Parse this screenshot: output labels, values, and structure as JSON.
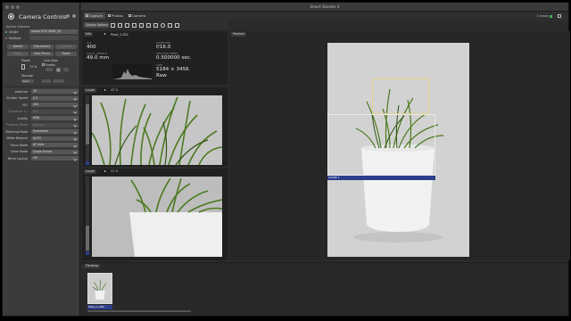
{
  "window": {
    "title": "Smart Shooter 4"
  },
  "left_panel": {
    "title": "Camera Controls",
    "section_active": "Active Camera",
    "single_label": "Single",
    "camera_model": "Canon EOS 5DSR_T6",
    "multiple_label": "Multiple",
    "buttons": [
      "Detect",
      "Disconnect",
      "Connect"
    ],
    "buttons2": [
      "Sleep",
      "Auto Focus",
      "Reset"
    ],
    "power_label": "Power",
    "power_value": "75 %",
    "liveview_label": "Live View",
    "enable_label": "Enable",
    "storage_label": "Storage",
    "storage_value": "Card",
    "settings": [
      {
        "label": "Aperture",
        "value": "16",
        "dim": false
      },
      {
        "label": "Shutter Speed",
        "value": "0.5",
        "dim": false
      },
      {
        "label": "ISO",
        "value": "400",
        "dim": false
      },
      {
        "label": "Exposure +/-",
        "value": "0.0",
        "dim": true
      },
      {
        "label": "Quality",
        "value": "RAW",
        "dim": false
      },
      {
        "label": "Program Mode",
        "value": "Manual",
        "dim": true
      },
      {
        "label": "Metering Mode",
        "value": "Evaluative",
        "dim": false
      },
      {
        "label": "White Balance",
        "value": "AUTO",
        "dim": false
      },
      {
        "label": "Focus Mode",
        "value": "AF Auto",
        "dim": false
      },
      {
        "label": "Drive Mode",
        "value": "Single Frame",
        "dim": false
      },
      {
        "label": "Mirror Lockup",
        "value": "Off",
        "dim": false
      }
    ]
  },
  "tabs": [
    {
      "label": "Capture",
      "active": true
    },
    {
      "label": "Photos",
      "active": false
    },
    {
      "label": "Camera",
      "active": false
    }
  ],
  "status": {
    "text": "1 ready"
  },
  "toolbar": {
    "display_select": "Display Options"
  },
  "info": {
    "tag": "Info",
    "filename": "Plant_1.CR2",
    "iso_key": "ISO",
    "iso": "400",
    "aperture_key": "APERTURE",
    "aperture": "f/16.0",
    "focal_key": "FOCAL LENGTH",
    "focal": "49.0 mm",
    "shutter_key": "SHUTTER SPEED",
    "shutter": "0.500000 sec.",
    "size_key": "SIZE",
    "size": "5184 × 3456",
    "format": "Raw"
  },
  "loupe1": {
    "tag": "Loupe",
    "zoom": "42 %"
  },
  "loupe2": {
    "tag": "Loupe",
    "zoom": "22 %"
  },
  "preview": {
    "tag": "Preview",
    "loupe_label": "LOUPE 1"
  },
  "filmstrip": {
    "tag": "Filmstrip",
    "thumb_label": "Plant_1.CR2"
  }
}
